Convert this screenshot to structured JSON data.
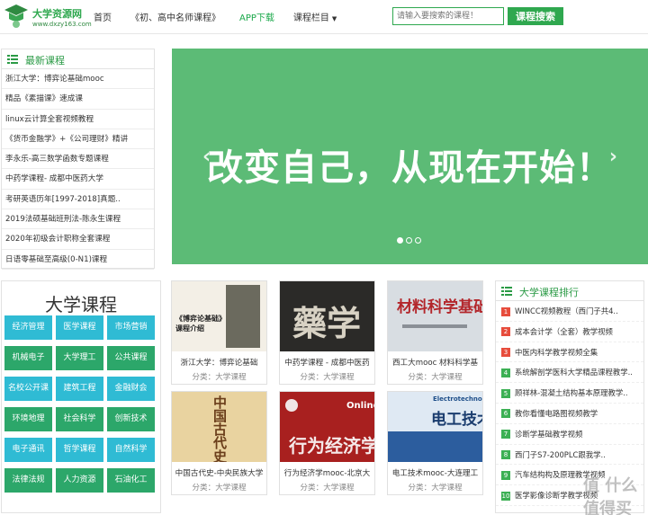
{
  "header": {
    "logo_title": "大学资源网",
    "logo_url": "www.dxzy163.com",
    "nav": [
      {
        "label": "首页"
      },
      {
        "label": "《初、高中名师课程》"
      },
      {
        "label": "APP下载"
      },
      {
        "label": "课程栏目"
      }
    ],
    "search_placeholder": "请输入要搜索的课程！",
    "search_button": "课程搜索"
  },
  "latest": {
    "title": "最新课程",
    "items": [
      "浙江大学：博弈论基础mooc",
      "精品《素描课》速成课",
      "linux云计算全套视频教程",
      "《货币金融学》+《公司理财》精讲",
      "李永乐-高三数学函数专题课程",
      "中药学课程- 成都中医药大学",
      "考研英语历年[1997-2018]真题..",
      "2019法硕基础班刑法-陈永生课程",
      "2020年初级会计职称全套课程",
      "日语零基础至高级(0-N1)课程"
    ]
  },
  "banner": {
    "text": "改变自己，从现在开始！",
    "prev": "‹",
    "next": "›"
  },
  "uni": {
    "title": "大学课程",
    "categories": [
      "经济管理",
      "医学课程",
      "市场营销",
      "机械电子",
      "大学理工",
      "公共课程",
      "名校公开课",
      "建筑工程",
      "金融财会",
      "环境地理",
      "社会科学",
      "创新技术",
      "电子通讯",
      "哲学课程",
      "自然科学",
      "法律法规",
      "人力资源",
      "石油化工"
    ]
  },
  "cards": [
    {
      "title": "浙江大学：博弈论基础",
      "meta": "分类：大学课程",
      "thumb": "《博弈论基础》课程介绍"
    },
    {
      "title": "中药学课程 - 成都中医药",
      "meta": "分类：大学课程",
      "thumb": "藥学"
    },
    {
      "title": "西工大mooc 材料科学基",
      "meta": "分类：大学课程",
      "thumb": "材料科学基础"
    },
    {
      "title": "中国古代史-中央民族大学",
      "meta": "分类：大学课程",
      "thumb": "中国古代史"
    },
    {
      "title": "行为经济学mooc-北京大",
      "meta": "分类：大学课程",
      "thumb": "行为经济学"
    },
    {
      "title": "电工技术mooc-大连理工",
      "meta": "分类：大学课程",
      "thumb": "电工技术"
    }
  ],
  "thumbs_extra": {
    "online": "Online",
    "electro": "Electrotechnology"
  },
  "rank": {
    "title": "大学课程排行",
    "items": [
      {
        "num": "1",
        "label": "WINCC视频教程（西门子共4.."
      },
      {
        "num": "2",
        "label": "成本会计学（全套）教学视频"
      },
      {
        "num": "3",
        "label": "中医内科学教学视频全集"
      },
      {
        "num": "4",
        "label": "系统解剖学医科大学精品课程教学.."
      },
      {
        "num": "5",
        "label": "顾祥林-混凝土结构基本原理教学.."
      },
      {
        "num": "6",
        "label": "教你看懂电路图视频教学"
      },
      {
        "num": "7",
        "label": "诊断学基础教学视频"
      },
      {
        "num": "8",
        "label": "西门子S7-200PLC跟我学.."
      },
      {
        "num": "9",
        "label": "汽车结构构及原理教学视频"
      },
      {
        "num": "10",
        "label": "医学影像诊断学教学视频"
      }
    ]
  },
  "watermark": "值 什么值得买"
}
